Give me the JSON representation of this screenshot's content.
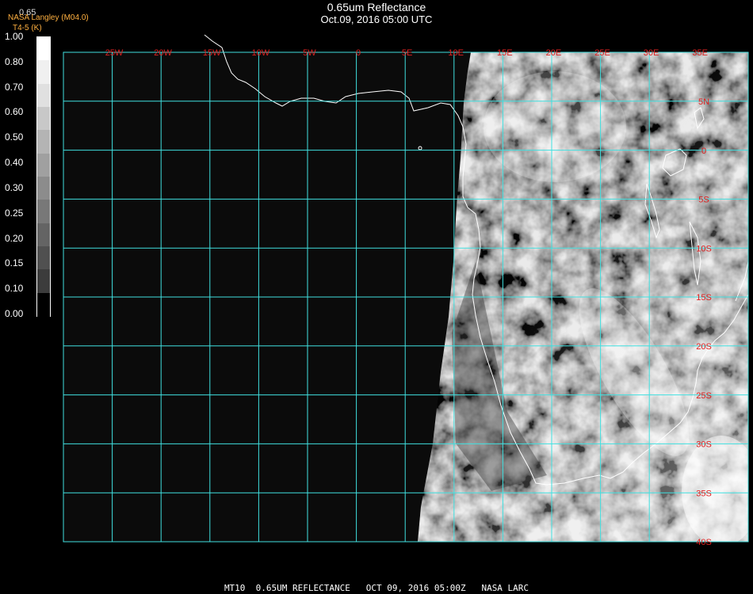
{
  "header": {
    "title": "0.65um Reflectance",
    "subtitle": "Oct.09, 2016 05:00 UTC",
    "credit_line1": "NASA Langley (M04.0)",
    "credit_line2": "T4-5 (K)",
    "scale_top": "0.65"
  },
  "colorbar": {
    "labels": [
      "1.00",
      "0.80",
      "0.70",
      "0.60",
      "0.50",
      "0.40",
      "0.30",
      "0.25",
      "0.20",
      "0.15",
      "0.10",
      "0.00"
    ],
    "shades": [
      "#ffffff",
      "#f0f0f0",
      "#e0e0e0",
      "#c8c8c8",
      "#b4b4b4",
      "#a0a0a0",
      "#8c8c8c",
      "#787878",
      "#646464",
      "#505050",
      "#3c3c3c",
      "#000000"
    ]
  },
  "map": {
    "longitude_labels": [
      "25W",
      "20W",
      "15W",
      "10W",
      "5W",
      "0",
      "5E",
      "10E",
      "15E",
      "20E",
      "25E",
      "30E",
      "35E"
    ],
    "latitude_labels": [
      "5N",
      "0",
      "5S",
      "10S",
      "15S",
      "20S",
      "25S",
      "30S",
      "35S",
      "40S"
    ],
    "grid_color": "#40e0e0",
    "coast_color": "#ffffff",
    "label_color": "#e02020"
  },
  "footer": {
    "text": "MT10  0.65UM REFLECTANCE   OCT 09, 2016 05:00Z   NASA LARC"
  }
}
